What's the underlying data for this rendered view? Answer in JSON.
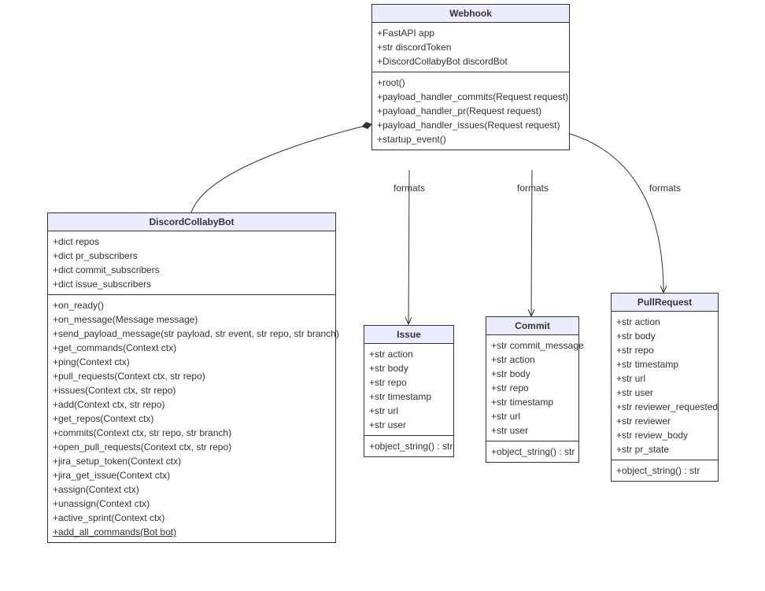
{
  "chart_data": {
    "type": "uml-class-diagram",
    "classes": [
      {
        "name": "Webhook",
        "attributes": [
          "+FastAPI app",
          "+str discordToken",
          "+DiscordCollabyBot discordBot"
        ],
        "methods": [
          "+root()",
          "+payload_handler_commits(Request request)",
          "+payload_handler_pr(Request request)",
          "+payload_handler_issues(Request request)",
          "+startup_event()"
        ]
      },
      {
        "name": "DiscordCollabyBot",
        "attributes": [
          "+dict repos",
          "+dict pr_subscribers",
          "+dict commit_subscribers",
          "+dict issue_subscribers"
        ],
        "methods": [
          "+on_ready()",
          "+on_message(Message message)",
          "+send_payload_message(str payload, str event, str repo, str branch)",
          "+get_commands(Context ctx)",
          "+ping(Context ctx)",
          "+pull_requests(Context ctx, str repo)",
          "+issues(Context ctx, str repo)",
          "+add(Context ctx, str repo)",
          "+get_repos(Context ctx)",
          "+commits(Context ctx, str repo, str branch)",
          "+open_pull_requests(Context ctx, str repo)",
          "+jira_setup_token(Context ctx)",
          "+jira_get_issue(Context ctx)",
          "+assign(Context ctx)",
          "+unassign(Context ctx)",
          "+active_sprint(Context ctx)",
          "+add_all_commands(Bot bot)"
        ]
      },
      {
        "name": "Issue",
        "attributes": [
          "+str action",
          "+str body",
          "+str repo",
          "+str timestamp",
          "+str url",
          "+str user"
        ],
        "methods": [
          "+object_string() : str"
        ]
      },
      {
        "name": "Commit",
        "attributes": [
          "+str commit_message",
          "+str action",
          "+str body",
          "+str repo",
          "+str timestamp",
          "+str url",
          "+str user"
        ],
        "methods": [
          "+object_string() : str"
        ]
      },
      {
        "name": "PullRequest",
        "attributes": [
          "+str action",
          "+str body",
          "+str repo",
          "+str timestamp",
          "+str url",
          "+str user",
          "+str reviewer_requested",
          "+str reviewer",
          "+str review_body",
          "+str pr_state"
        ],
        "methods": [
          "+object_string() : str"
        ]
      }
    ],
    "relations": [
      {
        "from": "Webhook",
        "to": "DiscordCollabyBot",
        "type": "composition"
      },
      {
        "from": "Webhook",
        "to": "Issue",
        "type": "dependency",
        "label": "formats"
      },
      {
        "from": "Webhook",
        "to": "Commit",
        "type": "dependency",
        "label": "formats"
      },
      {
        "from": "Webhook",
        "to": "PullRequest",
        "type": "dependency",
        "label": "formats"
      }
    ]
  },
  "webhook": {
    "title": "Webhook",
    "attrs": [
      "+FastAPI app",
      "+str discordToken",
      "+DiscordCollabyBot discordBot"
    ],
    "methods": [
      "+root()",
      "+payload_handler_commits(Request request)",
      "+payload_handler_pr(Request request)",
      "+payload_handler_issues(Request request)",
      "+startup_event()"
    ]
  },
  "bot": {
    "title": "DiscordCollabyBot",
    "attrs": [
      "+dict repos",
      "+dict pr_subscribers",
      "+dict commit_subscribers",
      "+dict issue_subscribers"
    ],
    "methods": [
      "+on_ready()",
      "+on_message(Message message)",
      "+send_payload_message(str payload, str event, str repo, str branch)",
      "+get_commands(Context ctx)",
      "+ping(Context ctx)",
      "+pull_requests(Context ctx, str repo)",
      "+issues(Context ctx, str repo)",
      "+add(Context ctx, str repo)",
      "+get_repos(Context ctx)",
      "+commits(Context ctx, str repo, str branch)",
      "+open_pull_requests(Context ctx, str repo)",
      "+jira_setup_token(Context ctx)",
      "+jira_get_issue(Context ctx)",
      "+assign(Context ctx)",
      "+unassign(Context ctx)",
      "+active_sprint(Context ctx)",
      "+add_all_commands(Bot bot)"
    ],
    "static_method": "+add_all_commands(Bot bot)"
  },
  "issue": {
    "title": "Issue",
    "attrs": [
      "+str action",
      "+str body",
      "+str repo",
      "+str timestamp",
      "+str url",
      "+str user"
    ],
    "methods": [
      "+object_string() : str"
    ]
  },
  "commit": {
    "title": "Commit",
    "attrs": [
      "+str commit_message",
      "+str action",
      "+str body",
      "+str repo",
      "+str timestamp",
      "+str url",
      "+str user"
    ],
    "methods": [
      "+object_string() : str"
    ]
  },
  "pr": {
    "title": "PullRequest",
    "attrs": [
      "+str action",
      "+str body",
      "+str repo",
      "+str timestamp",
      "+str url",
      "+str user",
      "+str reviewer_requested",
      "+str reviewer",
      "+str review_body",
      "+str pr_state"
    ],
    "methods": [
      "+object_string() : str"
    ]
  },
  "labels": {
    "formats1": "formats",
    "formats2": "formats",
    "formats3": "formats"
  }
}
